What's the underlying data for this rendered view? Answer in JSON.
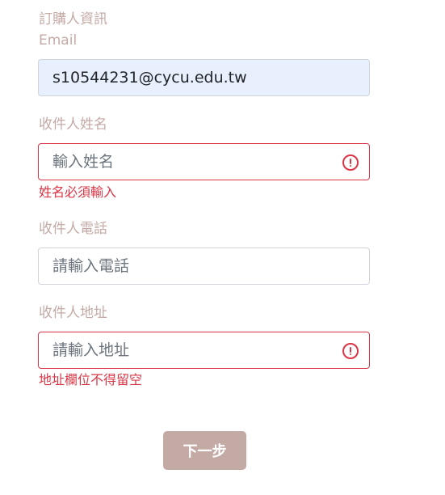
{
  "form": {
    "section_title": "訂購人資訊",
    "email": {
      "label": "Email",
      "value": "s10544231@cycu.edu.tw"
    },
    "name": {
      "label": "收件人姓名",
      "placeholder": "輸入姓名",
      "error": "姓名必須輸入"
    },
    "phone": {
      "label": "收件人電話",
      "placeholder": "請輸入電話"
    },
    "address": {
      "label": "收件人地址",
      "placeholder": "請輸入地址",
      "error": "地址欄位不得留空"
    },
    "next_label": "下一步"
  },
  "colors": {
    "label": "#c4aaa5",
    "error": "#dc3545",
    "autofill_bg": "#e8f0fe",
    "button_bg": "#c4aaa5"
  },
  "icons": {
    "invalid": "exclamation-circle-icon"
  }
}
